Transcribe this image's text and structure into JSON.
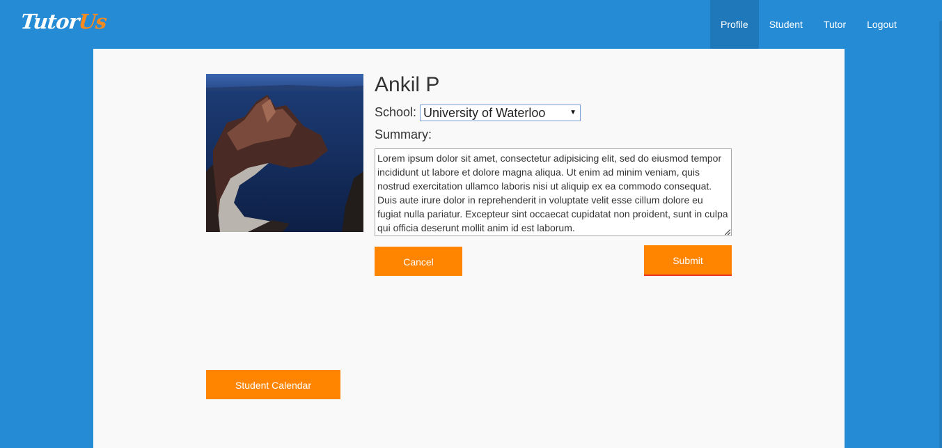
{
  "app": {
    "logo_part1": "Tutor",
    "logo_part2": "Us"
  },
  "nav": {
    "items": [
      {
        "label": "Profile",
        "active": true
      },
      {
        "label": "Student",
        "active": false
      },
      {
        "label": "Tutor",
        "active": false
      },
      {
        "label": "Logout",
        "active": false
      }
    ]
  },
  "profile": {
    "name": "Ankil P",
    "school_label": "School:",
    "school_value": "University of Waterloo",
    "summary_label": "Summary:",
    "summary_text": "Lorem ipsum dolor sit amet, consectetur adipisicing elit, sed do eiusmod tempor incididunt ut labore et dolore magna aliqua. Ut enim ad minim veniam, quis nostrud exercitation ullamco laboris nisi ut aliquip ex ea commodo consequat. Duis aute irure dolor in reprehenderit in voluptate velit esse cillum dolore eu fugiat nulla pariatur. Excepteur sint occaecat cupidatat non proident, sunt in culpa qui officia deserunt mollit anim id est laborum."
  },
  "buttons": {
    "cancel": "Cancel",
    "submit": "Submit",
    "calendar": "Student Calendar"
  },
  "colors": {
    "brand_blue": "#268bd5",
    "nav_active": "#1f78ba",
    "accent_orange": "#ff8500",
    "logo_orange": "#f58a1f",
    "panel_bg": "#f9f9f9"
  }
}
